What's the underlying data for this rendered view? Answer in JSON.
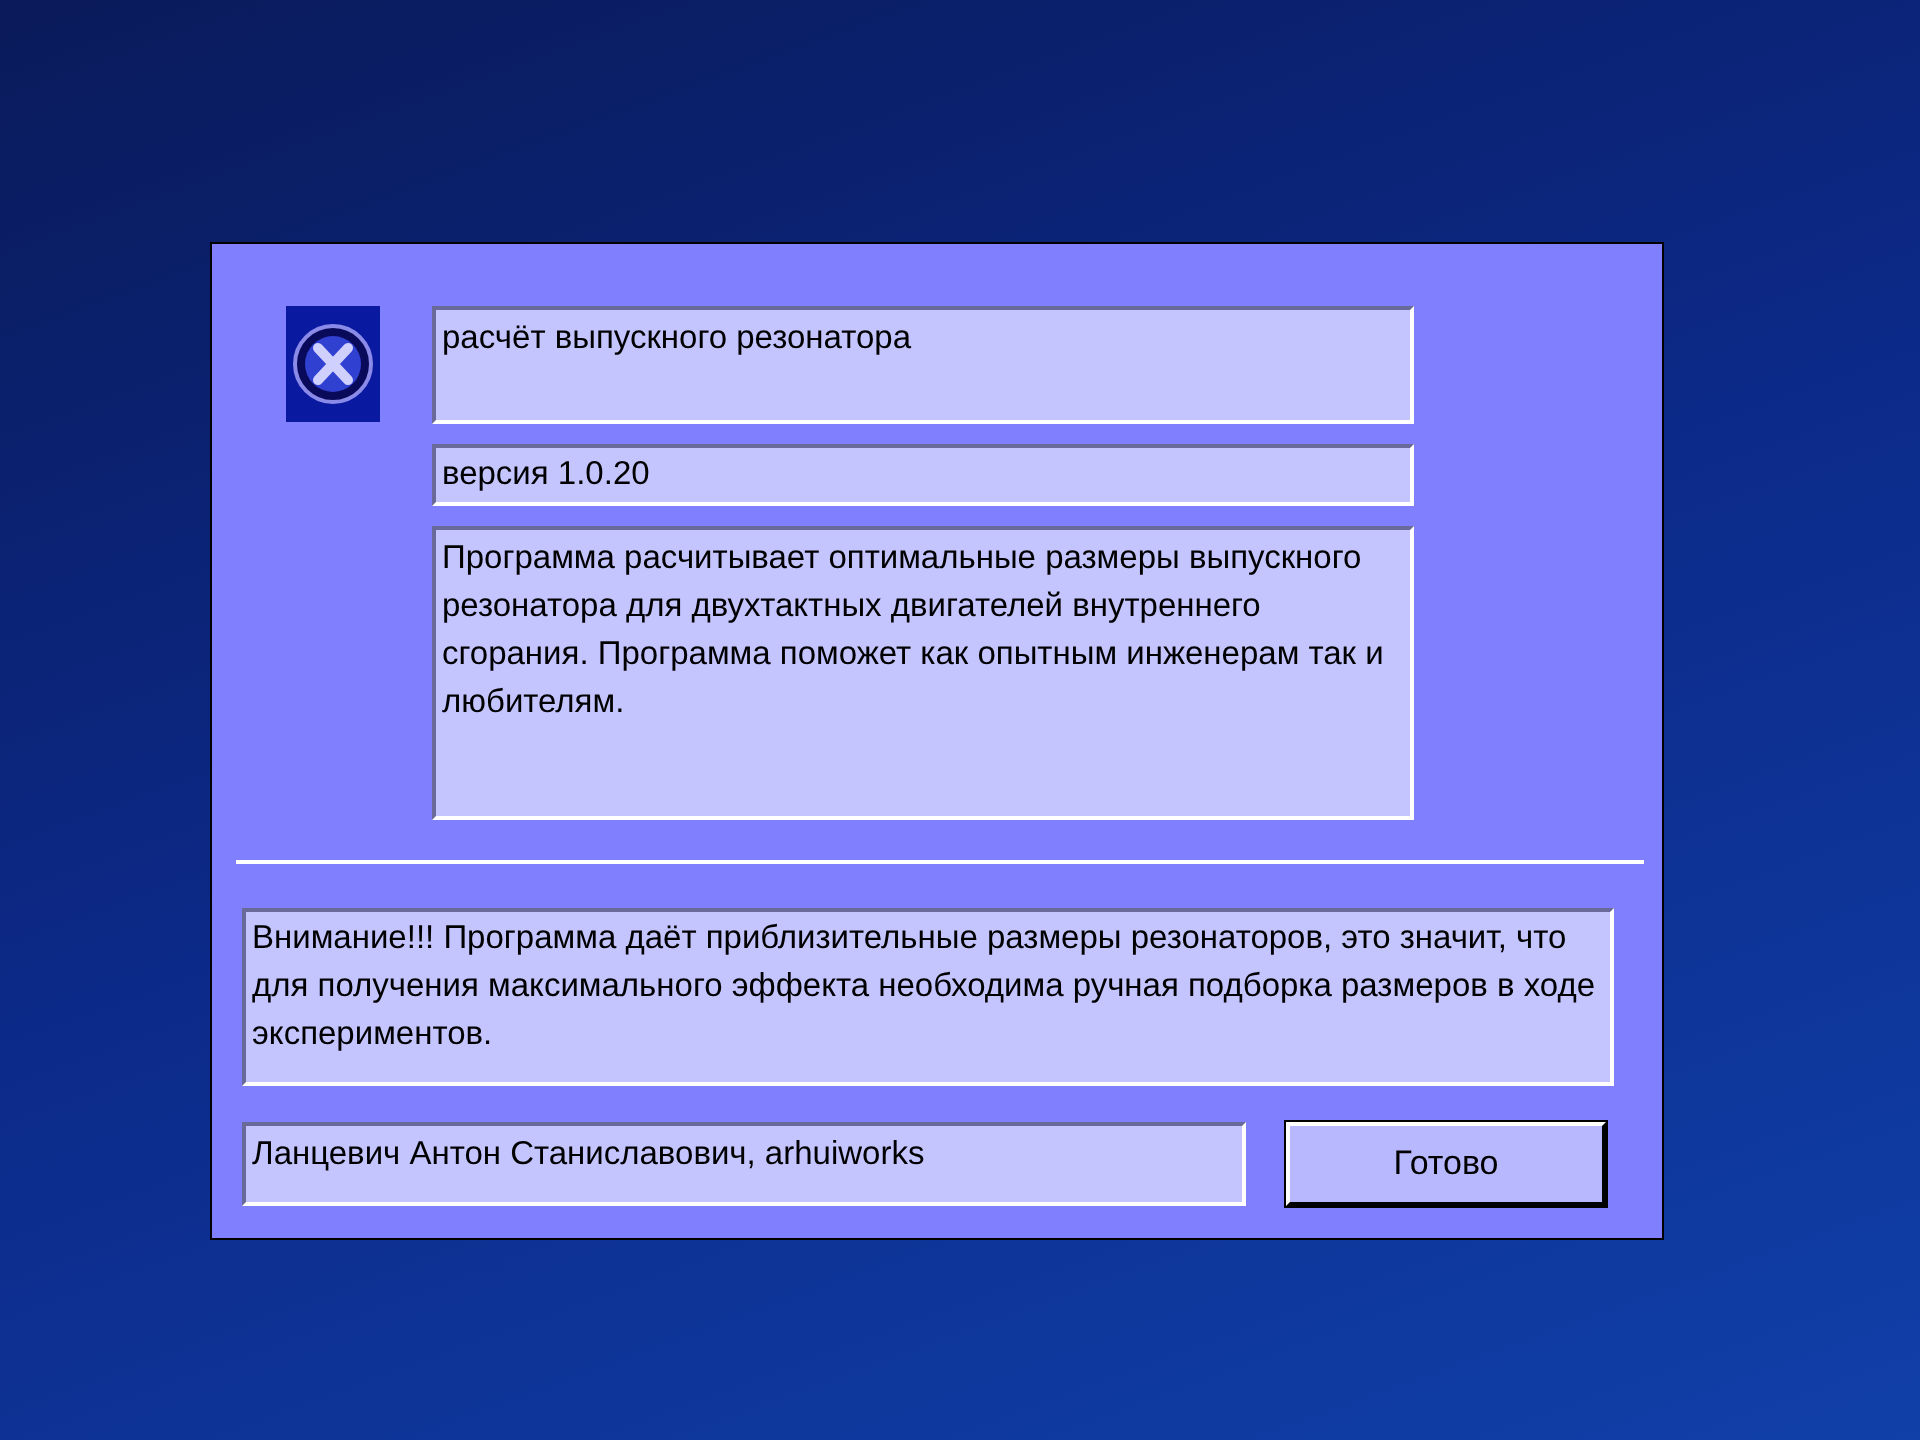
{
  "dialog": {
    "title_field": "расчёт выпускного резонатора",
    "version_field": "версия 1.0.20",
    "description": "Программа расчитывает оптимальные размеры выпускного резонатора для двухтактных двигателей внутреннего сгорания. Программа поможет как опытным инженерам так и любителям.",
    "warning": "Внимание!!! Программа даёт приблизительные размеры резонаторов, это значит, что для получения максимального эффекта необходима ручная подборка размеров в ходе экспериментов.",
    "author": "Ланцевич Антон Станиславович, arhuiworks",
    "button": "Готово"
  }
}
